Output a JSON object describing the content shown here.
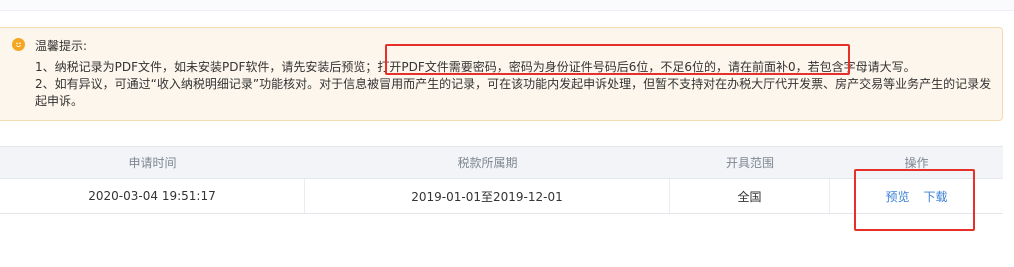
{
  "notice": {
    "icon": "smile-icon",
    "title": "温馨提示:",
    "line1": "1、纳税记录为PDF文件，如未安装PDF软件，请先安装后预览；打开PDF文件需要密码，密码为身份证件号码后6位，不足6位的，请在前面补0，若包含字母请大写。",
    "line2": "2、如有异议，可通过“收入纳税明细记录”功能核对。对于信息被冒用而产生的记录，可在该功能内发起申诉处理，但暂不支持对在办税大厅代开发票、房产交易等业务产生的记录发起申诉。"
  },
  "table": {
    "headers": [
      "申请时间",
      "税款所属期",
      "开具范围",
      "操作"
    ],
    "rows": [
      {
        "apply_time": "2020-03-04 19:51:17",
        "period": "2019-01-01至2019-12-01",
        "scope": "全国",
        "actions": [
          "预览",
          "下载"
        ]
      }
    ]
  },
  "colors": {
    "highlight": "#e8302a",
    "link": "#3a7fd5",
    "notice_bg": "#fdf6ec"
  }
}
